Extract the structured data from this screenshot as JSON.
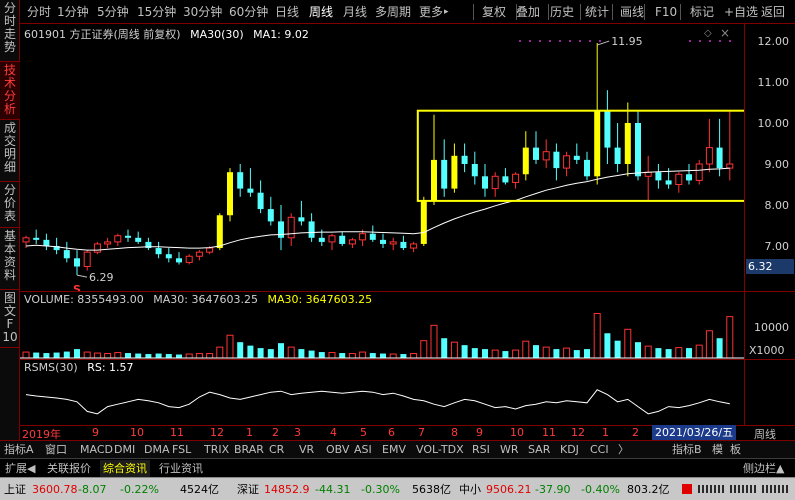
{
  "toolbar": {
    "items": [
      "分时",
      "1分钟",
      "5分钟",
      "15分钟",
      "30分钟",
      "60分钟",
      "日线",
      "周线",
      "月线",
      "多周期",
      "更多"
    ],
    "more_arrow": "▸",
    "right_items": [
      "复权",
      "叠加",
      "历史",
      "统计",
      "画线",
      "F10",
      "标记",
      "+自选",
      "返回"
    ]
  },
  "left_tabs": [
    [
      "分",
      "时",
      "走",
      "势"
    ],
    [
      "技",
      "术",
      "分",
      "析"
    ],
    [
      "成",
      "交",
      "明",
      "细"
    ],
    [
      "分",
      "价",
      "表"
    ],
    [
      "基",
      "本",
      "资",
      "料"
    ],
    [
      "图",
      "文",
      "F",
      "10"
    ]
  ],
  "price_pane": {
    "stock": "601901 方正证券(周线 前复权)",
    "ma30_legend": "MA30(30)",
    "ma1_legend": "MA1: 9.02",
    "high_label": "11.95",
    "low_label": "6.29",
    "current_price": "6.32",
    "s_marker": "S",
    "yticks": [
      "12.00",
      "11.00",
      "10.00",
      "9.00",
      "8.00",
      "7.00"
    ]
  },
  "volume_pane": {
    "title": "VOLUME: 8355493.00",
    "ma30_a": "MA30: 3647603.25",
    "ma30_b": "MA30: 3647603.25",
    "ytick": "10000",
    "unit": "X1000"
  },
  "rsms_pane": {
    "title": "RSMS(30)",
    "rs": "RS: 1.57"
  },
  "x_axis": {
    "labels": [
      "2019年",
      "9",
      "10",
      "11",
      "12",
      "1",
      "2",
      "3",
      "4",
      "5",
      "6",
      "7",
      "8",
      "9",
      "10",
      "11",
      "12",
      "1",
      "2",
      "3"
    ],
    "date_box": "2021/03/26/五",
    "right_label": "周线"
  },
  "index_bar": {
    "items": [
      "指标A",
      "窗口",
      "MACD",
      "DMI",
      "DMA",
      "FSL",
      "TRIX",
      "BRAR",
      "CR",
      "VR",
      "OBV",
      "ASI",
      "EMV",
      "VOL-TDX",
      "RSI",
      "WR",
      "SAR",
      "KDJ",
      "CCI",
      "〉"
    ],
    "right_items": [
      "指标B",
      "模",
      "板"
    ]
  },
  "tab_bar": {
    "items": [
      "扩展◀",
      "关联报价",
      "综合资讯",
      "行业资讯"
    ],
    "right": "侧边栏▲"
  },
  "status_bar": {
    "sh_name": "上证",
    "sh_price": "3600.78",
    "sh_change": "-8.07",
    "sh_pct": "-0.22%",
    "sh_amt": "4524亿",
    "sz_name": "深证",
    "sz_price": "14852.9",
    "sz_change": "-44.31",
    "sz_pct": "-0.30%",
    "sz_amt": "5638亿",
    "zx_name": "中小",
    "zx_price": "9506.21",
    "zx_change": "-37.90",
    "zx_pct": "-0.40%",
    "zx_amt": "803.2亿"
  },
  "chart_data": {
    "type": "candlestick",
    "title": "601901 方正证券(周线 前复权)",
    "ylim": [
      6.0,
      12.5
    ],
    "high": 11.95,
    "low": 6.29,
    "last_close": 9.02,
    "highlight_range": [
      8.1,
      10.3
    ],
    "colors": {
      "up": "#ff3232",
      "down": "#54ffff",
      "limit": "#ffff00",
      "ma": "#ffffff",
      "box": "#ffff00"
    },
    "candles": [
      [
        7.1,
        7.25,
        6.95,
        7.2
      ],
      [
        7.2,
        7.4,
        7.05,
        7.15
      ],
      [
        7.15,
        7.3,
        6.9,
        7.0
      ],
      [
        7.0,
        7.2,
        6.8,
        6.9
      ],
      [
        6.9,
        7.1,
        6.6,
        6.7
      ],
      [
        6.7,
        6.9,
        6.29,
        6.5
      ],
      [
        6.5,
        6.9,
        6.4,
        6.85
      ],
      [
        6.85,
        7.1,
        6.8,
        7.05
      ],
      [
        7.05,
        7.2,
        6.95,
        7.1
      ],
      [
        7.1,
        7.3,
        7.0,
        7.25
      ],
      [
        7.25,
        7.4,
        7.1,
        7.2
      ],
      [
        7.2,
        7.35,
        7.05,
        7.1
      ],
      [
        7.1,
        7.2,
        6.9,
        6.95
      ],
      [
        6.95,
        7.1,
        6.7,
        6.8
      ],
      [
        6.8,
        6.95,
        6.6,
        6.7
      ],
      [
        6.7,
        6.85,
        6.55,
        6.6
      ],
      [
        6.6,
        6.8,
        6.55,
        6.75
      ],
      [
        6.75,
        6.9,
        6.65,
        6.85
      ],
      [
        6.85,
        7.0,
        6.8,
        6.95
      ],
      [
        6.95,
        7.8,
        6.9,
        7.75
      ],
      [
        7.75,
        8.9,
        7.6,
        8.8
      ],
      [
        8.8,
        9.0,
        8.2,
        8.4
      ],
      [
        8.4,
        8.9,
        8.2,
        8.3
      ],
      [
        8.3,
        8.6,
        7.8,
        7.9
      ],
      [
        7.9,
        8.2,
        7.5,
        7.6
      ],
      [
        7.6,
        8.0,
        6.9,
        7.2
      ],
      [
        7.2,
        7.8,
        7.0,
        7.7
      ],
      [
        7.7,
        8.1,
        7.5,
        7.6
      ],
      [
        7.6,
        7.8,
        7.1,
        7.2
      ],
      [
        7.2,
        7.4,
        7.0,
        7.1
      ],
      [
        7.1,
        7.3,
        6.9,
        7.25
      ],
      [
        7.25,
        7.35,
        7.0,
        7.05
      ],
      [
        7.05,
        7.2,
        6.95,
        7.15
      ],
      [
        7.15,
        7.4,
        7.0,
        7.3
      ],
      [
        7.3,
        7.5,
        7.1,
        7.15
      ],
      [
        7.15,
        7.3,
        6.95,
        7.05
      ],
      [
        7.05,
        7.2,
        6.9,
        7.1
      ],
      [
        7.1,
        7.25,
        6.9,
        6.95
      ],
      [
        6.95,
        7.1,
        6.85,
        7.05
      ],
      [
        7.05,
        8.2,
        7.0,
        8.1
      ],
      [
        8.1,
        10.2,
        8.0,
        9.1
      ],
      [
        9.1,
        9.6,
        8.2,
        8.4
      ],
      [
        8.4,
        9.5,
        8.3,
        9.2
      ],
      [
        9.2,
        9.5,
        8.8,
        9.0
      ],
      [
        9.0,
        9.3,
        8.5,
        8.7
      ],
      [
        8.7,
        9.0,
        8.2,
        8.4
      ],
      [
        8.4,
        8.8,
        8.2,
        8.7
      ],
      [
        8.7,
        8.9,
        8.5,
        8.55
      ],
      [
        8.55,
        8.8,
        8.4,
        8.75
      ],
      [
        8.75,
        9.8,
        8.6,
        9.4
      ],
      [
        9.4,
        9.8,
        9.0,
        9.1
      ],
      [
        9.1,
        9.6,
        8.9,
        9.3
      ],
      [
        9.3,
        9.5,
        8.6,
        8.9
      ],
      [
        8.9,
        9.3,
        8.7,
        9.2
      ],
      [
        9.2,
        9.5,
        9.0,
        9.1
      ],
      [
        9.1,
        9.3,
        8.6,
        8.7
      ],
      [
        8.7,
        11.95,
        8.5,
        10.3
      ],
      [
        10.3,
        10.8,
        9.0,
        9.4
      ],
      [
        9.4,
        10.0,
        8.8,
        9.0
      ],
      [
        9.0,
        10.5,
        8.7,
        10.0
      ],
      [
        10.0,
        10.3,
        8.6,
        8.7
      ],
      [
        8.7,
        9.2,
        8.1,
        8.8
      ],
      [
        8.8,
        9.0,
        8.4,
        8.6
      ],
      [
        8.6,
        8.9,
        8.4,
        8.5
      ],
      [
        8.5,
        8.8,
        8.3,
        8.75
      ],
      [
        8.75,
        9.0,
        8.5,
        8.6
      ],
      [
        8.6,
        9.1,
        8.5,
        9.0
      ],
      [
        9.0,
        10.1,
        8.8,
        9.4
      ],
      [
        9.4,
        10.1,
        8.7,
        8.9
      ],
      [
        8.9,
        10.3,
        8.6,
        9.0
      ]
    ],
    "ma30": [
      7.0,
      7.02,
      7.0,
      6.98,
      6.95,
      6.92,
      6.9,
      6.9,
      6.92,
      6.94,
      6.96,
      6.97,
      6.98,
      6.98,
      6.97,
      6.96,
      6.95,
      6.95,
      6.96,
      7.0,
      7.08,
      7.15,
      7.2,
      7.24,
      7.27,
      7.28,
      7.3,
      7.32,
      7.33,
      7.34,
      7.34,
      7.35,
      7.35,
      7.35,
      7.34,
      7.33,
      7.32,
      7.31,
      7.3,
      7.33,
      7.45,
      7.56,
      7.66,
      7.75,
      7.83,
      7.9,
      7.98,
      8.05,
      8.11,
      8.2,
      8.28,
      8.36,
      8.42,
      8.48,
      8.53,
      8.57,
      8.63,
      8.68,
      8.72,
      8.76,
      8.78,
      8.8,
      8.81,
      8.82,
      8.83,
      8.84,
      8.85,
      8.87,
      8.88,
      8.9
    ],
    "volume": [
      1.2,
      1.1,
      1.0,
      1.1,
      1.3,
      1.8,
      1.2,
      1.0,
      0.9,
      1.1,
      1.0,
      0.9,
      0.8,
      0.9,
      0.8,
      0.7,
      0.8,
      0.9,
      0.9,
      2.2,
      4.6,
      3.2,
      2.5,
      2.0,
      1.8,
      3.0,
      2.2,
      1.8,
      1.5,
      1.2,
      1.1,
      1.0,
      0.9,
      1.2,
      1.0,
      0.9,
      0.8,
      0.8,
      0.9,
      3.5,
      6.6,
      4.0,
      3.2,
      2.6,
      2.0,
      1.8,
      1.6,
      1.4,
      1.6,
      3.4,
      2.6,
      2.2,
      1.8,
      2.0,
      1.6,
      1.8,
      9.0,
      5.0,
      3.5,
      5.8,
      3.2,
      2.4,
      2.0,
      1.8,
      2.1,
      2.0,
      2.6,
      5.5,
      4.0,
      8.36
    ],
    "vol_ma30": 3.65,
    "rsms": [
      0.55,
      0.52,
      0.5,
      0.48,
      0.45,
      0.4,
      0.2,
      0.15,
      0.3,
      0.35,
      0.4,
      0.45,
      0.42,
      0.38,
      0.3,
      0.28,
      0.35,
      0.5,
      0.6,
      0.55,
      0.48,
      0.45,
      0.5,
      0.55,
      0.6,
      0.62,
      0.55,
      0.58,
      0.6,
      0.62,
      0.6,
      0.58,
      0.6,
      0.62,
      0.6,
      0.55,
      0.58,
      0.52,
      0.45,
      0.42,
      0.35,
      0.3,
      0.38,
      0.45,
      0.42,
      0.35,
      0.28,
      0.3,
      0.25,
      0.32,
      0.35,
      0.4,
      0.38,
      0.42,
      0.4,
      0.38,
      0.65,
      0.55,
      0.4,
      0.45,
      0.3,
      0.15,
      0.2,
      0.3,
      0.28,
      0.32,
      0.38,
      0.45,
      0.4,
      0.36
    ]
  }
}
